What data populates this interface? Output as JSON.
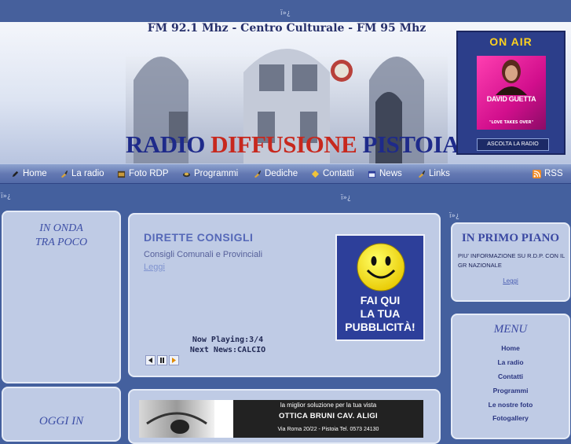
{
  "glyphs": {
    "top": "ï»¿",
    "mid_left": "ï»¿",
    "mid_center": "ï»¿",
    "mid_right": "ï»¿"
  },
  "header": {
    "headline": "FM 92.1 Mhz - Centro Culturale - FM 95 Mhz",
    "brand_part1": "RADIO",
    "brand_part2": "DIFFUSIONE",
    "brand_part3": "PISTOIA",
    "colors": {
      "blue": "#1e2a8a",
      "red": "#c7281e"
    }
  },
  "on_air": {
    "title": "ON AIR",
    "artist": "DAVID GUETTA",
    "track": "\"LOVE TAKES OVER\"",
    "listen_label": "ASCOLTA LA RADIO"
  },
  "nav": {
    "items": [
      {
        "label": "Home",
        "icon": "pencil-icon"
      },
      {
        "label": "La radio",
        "icon": "brush-icon"
      },
      {
        "label": "Foto RDP",
        "icon": "folder-icon"
      },
      {
        "label": "Programmi",
        "icon": "disc-icon"
      },
      {
        "label": "Dediche",
        "icon": "brush-icon"
      },
      {
        "label": "Contatti",
        "icon": "badge-icon"
      },
      {
        "label": "News",
        "icon": "calendar-icon"
      },
      {
        "label": "Links",
        "icon": "brush-icon"
      }
    ],
    "rss": "RSS"
  },
  "left_panel": {
    "line1": "IN ONDA",
    "line2": "TRA POCO"
  },
  "left_panel2": {
    "title": "OGGI IN"
  },
  "center": {
    "title": "DIRETTE CONSIGLI",
    "subtitle": "Consigli Comunali e Provinciali",
    "link": "Leggi",
    "ad_line1": "FAI QUI",
    "ad_line2": "LA TUA",
    "ad_line3": "PUBBLICITÀ!",
    "now_playing": "Now Playing:3/4",
    "next_news": "Next News:CALCIO"
  },
  "primo_piano": {
    "title": "IN PRIMO PIANO",
    "text": "PIU' INFORMAZIONE SU R.D.P. CON IL GR NAZIONALE",
    "link": "Leggi"
  },
  "menu": {
    "title": "MENU",
    "items": [
      "Home",
      "La radio",
      "Contatti",
      "Programmi",
      "Le nostre foto",
      "Fotogallery"
    ]
  },
  "bottom_ad": {
    "line1": "la miglior soluzione per la tua vista",
    "line2": "OTTICA BRUNI CAV. ALIGI",
    "line3": "Via Roma 20/22 - Pistoia Tel. 0573 24130"
  }
}
